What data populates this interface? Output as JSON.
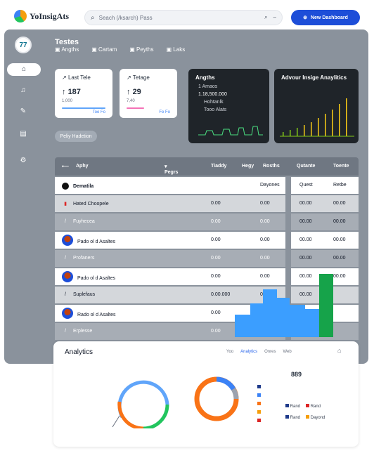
{
  "app": {
    "title": "YoInsigAts"
  },
  "search": {
    "placeholder": "Seach (/ksarch) Pass"
  },
  "new_button": {
    "label": "New Dashboard"
  },
  "sidebar": {
    "avatar": "77"
  },
  "header": {
    "title": "Testes",
    "tabs": [
      "Angths",
      "Cartam",
      "Peyths",
      "Laks"
    ]
  },
  "cards": [
    {
      "label": "Last Tele",
      "value": "187",
      "sub": "1,000",
      "link": "Toe Fo"
    },
    {
      "label": "Tetage",
      "value": "29",
      "sub": "7,40",
      "link": "Fe Fo"
    }
  ],
  "dark_card1": {
    "title": "Angths",
    "lines": [
      "1 Amaos",
      "1.18,500.000",
      "Hohtanlk",
      "Tooo Alats"
    ]
  },
  "dark_card2": {
    "title": "Advour Insige Anaylitics"
  },
  "filter_pill": {
    "label": "Peliy Hadetion"
  },
  "table": {
    "headers": [
      "Aphy",
      "Pegrs",
      "Tiaddy",
      "Hegy",
      "Rosths",
      "Qutante",
      "Toente"
    ],
    "section_label": "Dematila",
    "section_col2": "Dayones",
    "rows": [
      {
        "name": "Hated Choopele",
        "a": "0.00",
        "b": "0.00",
        "style": "gray",
        "icon": "cup"
      },
      {
        "name": "Fuyhecea",
        "a": "0.00",
        "b": "0.00",
        "style": "mid",
        "icon": "slash"
      },
      {
        "name": "Pado ol d Asaltes",
        "a": "0.00",
        "b": "0.00",
        "style": "light",
        "icon": "avatar"
      },
      {
        "name": "Profaners",
        "a": "0.00",
        "b": "0.00",
        "style": "mid",
        "icon": "slash"
      },
      {
        "name": "Pado ol d Asaltes",
        "a": "0.00",
        "b": "0.00",
        "style": "light",
        "icon": "avatar"
      },
      {
        "name": "Suplefaus",
        "a": "0.00.000",
        "b": "00.00",
        "style": "gray",
        "icon": "slash"
      },
      {
        "name": "Rado ol d Asaltes",
        "a": "0.00",
        "b": "0.00",
        "style": "light",
        "icon": "avatar"
      },
      {
        "name": "Erplesse",
        "a": "0.00",
        "b": "0.00",
        "style": "mid",
        "icon": "slash"
      }
    ],
    "right_col": [
      {
        "a": "Quest",
        "b": "Retbe"
      },
      {
        "a": "00.00",
        "b": "00.00"
      },
      {
        "a": "00.00",
        "b": "00.00"
      },
      {
        "a": "00.00",
        "b": "00.00"
      },
      {
        "a": "00.00",
        "b": "00.00"
      },
      {
        "a": "00.00",
        "b": "00.00"
      },
      {
        "a": "00.00",
        "b": ""
      },
      {
        "a": "",
        "b": ""
      },
      {
        "a": "",
        "b": ""
      }
    ]
  },
  "analytics": {
    "title": "Analytics",
    "tabs": [
      "Yoo",
      "Analytics",
      "Onres",
      "Web"
    ],
    "legend": [
      "",
      "",
      "",
      "",
      "",
      ""
    ],
    "big_value": "889",
    "leg2": [
      [
        "Rand",
        "Rand"
      ],
      [
        "Rand",
        "Dayond"
      ]
    ]
  },
  "colors": {
    "accent": "#1d4ed8",
    "blue": "#3b82f6",
    "green": "#22c55e",
    "orange": "#f97316",
    "dark": "#1f2429"
  }
}
